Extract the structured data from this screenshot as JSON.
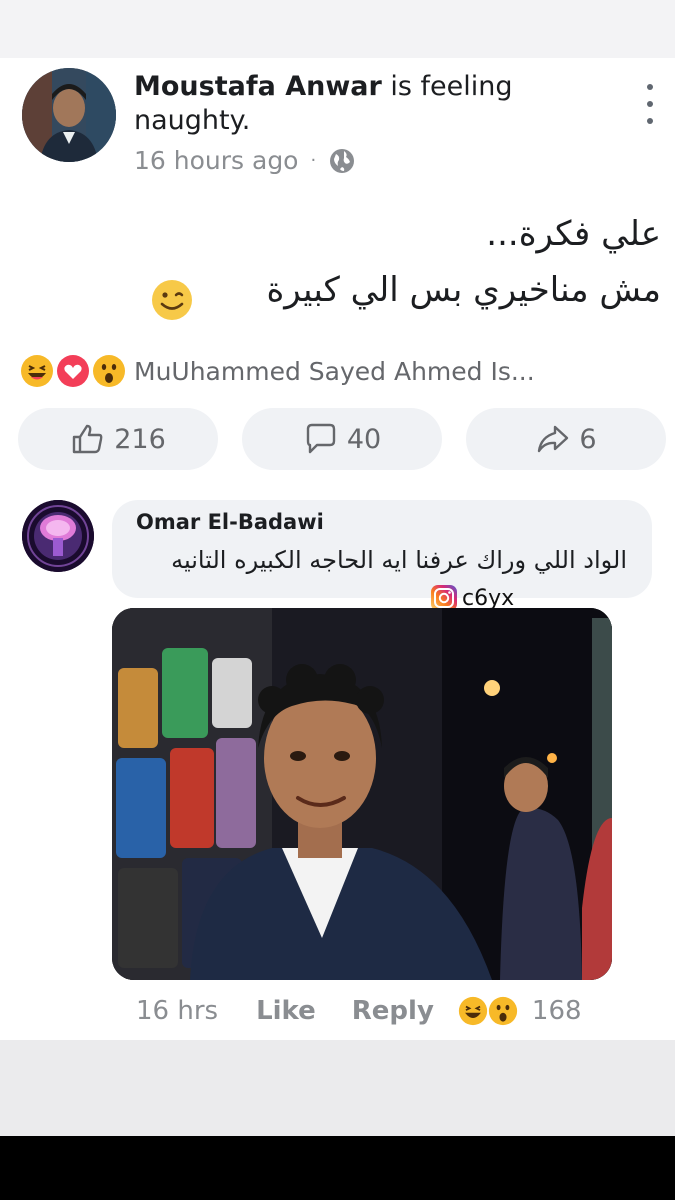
{
  "post": {
    "author_name": "Moustafa Anwar",
    "status_text": " is feeling naughty.",
    "time": "16 hours ago",
    "meta_separator": "·",
    "text_line1": "علي فكرة...",
    "text_line2": "مش مناخيري بس الي كبيرة",
    "reactions_summary": "MuUhammed Sayed Ahmed Is...",
    "likes": "216",
    "comments": "40",
    "shares": "6"
  },
  "comment": {
    "author": "Omar El-Badawi",
    "text": "الواد اللي وراك عرفنا ايه الحاجه الكبيره التانيه",
    "time": "16 hrs",
    "like_label": "Like",
    "reply_label": "Reply",
    "reaction_count": "168"
  },
  "watermark": {
    "handle": "c6yx"
  },
  "colors": {
    "text": "#1c1e21",
    "secondary": "#65676b",
    "pill_bg": "#f0f2f5",
    "reaction_yellow": "#f7b928",
    "love_red": "#f33e58"
  },
  "icons": [
    "globe-icon",
    "more-options-icon",
    "haha-reaction-icon",
    "love-reaction-icon",
    "wow-reaction-icon",
    "like-icon",
    "comment-icon",
    "share-icon",
    "instagram-icon",
    "smile-emoji-icon"
  ]
}
